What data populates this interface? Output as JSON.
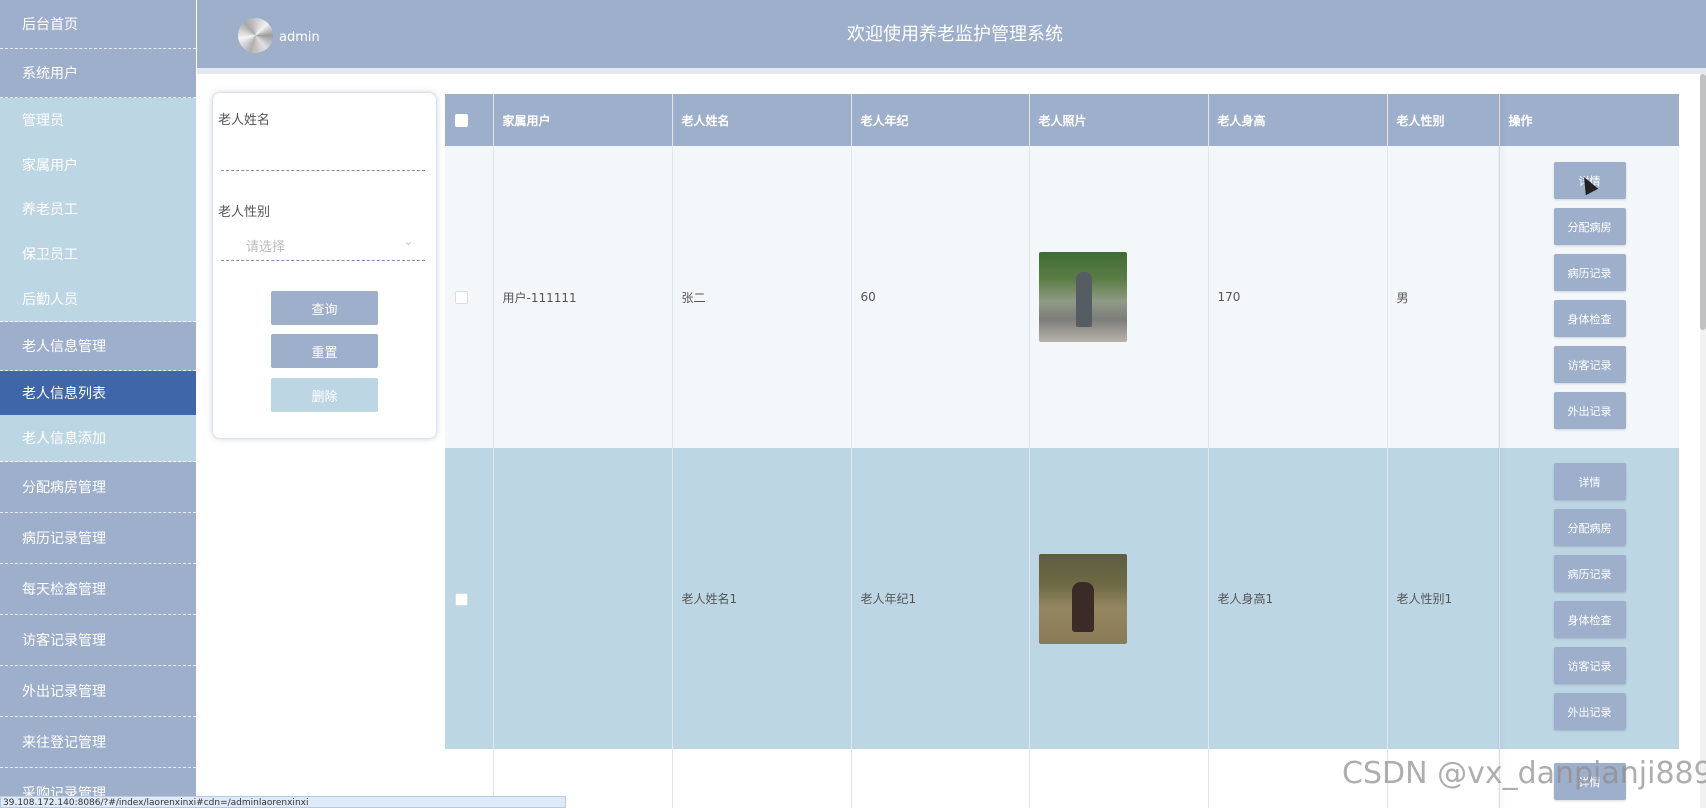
{
  "sidebar": {
    "items": [
      {
        "label": "后台首页",
        "type": "top"
      },
      {
        "label": "系统用户",
        "type": "top"
      },
      {
        "label": "管理员",
        "type": "sub"
      },
      {
        "label": "家属用户",
        "type": "sub"
      },
      {
        "label": "养老员工",
        "type": "sub"
      },
      {
        "label": "保卫员工",
        "type": "sub"
      },
      {
        "label": "后勤人员",
        "type": "sub"
      },
      {
        "label": "老人信息管理",
        "type": "top"
      },
      {
        "label": "老人信息列表",
        "type": "active"
      },
      {
        "label": "老人信息添加",
        "type": "sub"
      },
      {
        "label": "分配病房管理",
        "type": "top"
      },
      {
        "label": "病历记录管理",
        "type": "top"
      },
      {
        "label": "每天检查管理",
        "type": "top"
      },
      {
        "label": "访客记录管理",
        "type": "top"
      },
      {
        "label": "外出记录管理",
        "type": "top"
      },
      {
        "label": "来往登记管理",
        "type": "top"
      },
      {
        "label": "采购记录管理",
        "type": "top"
      }
    ]
  },
  "header": {
    "username": "admin",
    "title": "欢迎使用养老监护管理系统"
  },
  "search": {
    "name_label": "老人姓名",
    "name_value": "",
    "gender_label": "老人性别",
    "gender_placeholder": "请选择",
    "query_label": "查询",
    "reset_label": "重置",
    "delete_label": "删除"
  },
  "table": {
    "headers": [
      "家属用户",
      "老人姓名",
      "老人年纪",
      "老人照片",
      "老人身高",
      "老人性别",
      "操作"
    ],
    "rows": [
      {
        "family_user": "用户-111111",
        "name": "张二",
        "age": "60",
        "height": "170",
        "gender": "男"
      },
      {
        "family_user": "",
        "name": "老人姓名1",
        "age": "老人年纪1",
        "height": "老人身高1",
        "gender": "老人性别1"
      }
    ],
    "actions": [
      "详情",
      "分配病房",
      "病历记录",
      "身体检查",
      "访客记录",
      "外出记录"
    ]
  },
  "status_bar": {
    "url": "39.108.172.140:8086/?#/index/laorenxinxi#cdn=/adminlaorenxinxi"
  },
  "watermark": "CSDN @vx_danpianji889"
}
